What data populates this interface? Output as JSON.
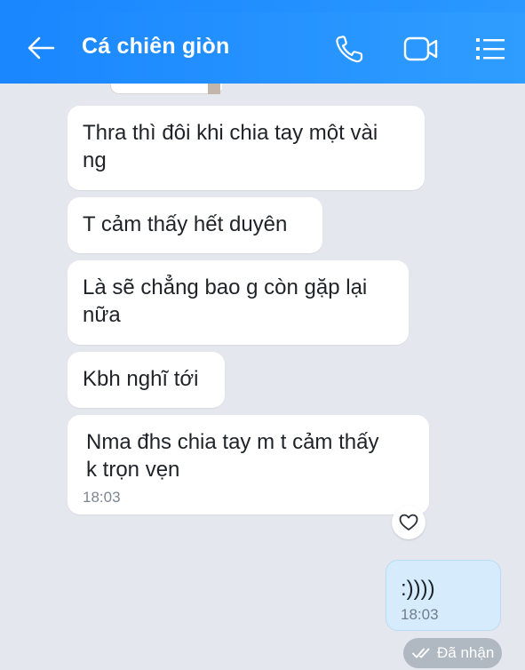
{
  "header": {
    "title": "Cá chiên giòn",
    "back_icon": "arrow-left-icon",
    "call_icon": "phone-icon",
    "video_icon": "video-camera-icon",
    "menu_icon": "list-menu-icon",
    "accent_color": "#1a86ff"
  },
  "messages": [
    {
      "text": "Thra thì đôi khi chia tay một vài\nng"
    },
    {
      "text": "T cảm thấy hết duyên"
    },
    {
      "text": "Là sẽ chẳng bao g còn gặp lại\nnữa"
    },
    {
      "text": "Kbh nghĩ tới"
    },
    {
      "text": "Nma đhs chia tay m t cảm thấy\nk trọn vẹn",
      "time": "18:03"
    }
  ],
  "reaction": {
    "icon": "heart-icon"
  },
  "sent_message": {
    "text": ":))))",
    "time": "18:03",
    "bubble_color": "#d6ecfd"
  },
  "delivery_status": {
    "icon": "double-check-icon",
    "label": "Đã nhận"
  }
}
